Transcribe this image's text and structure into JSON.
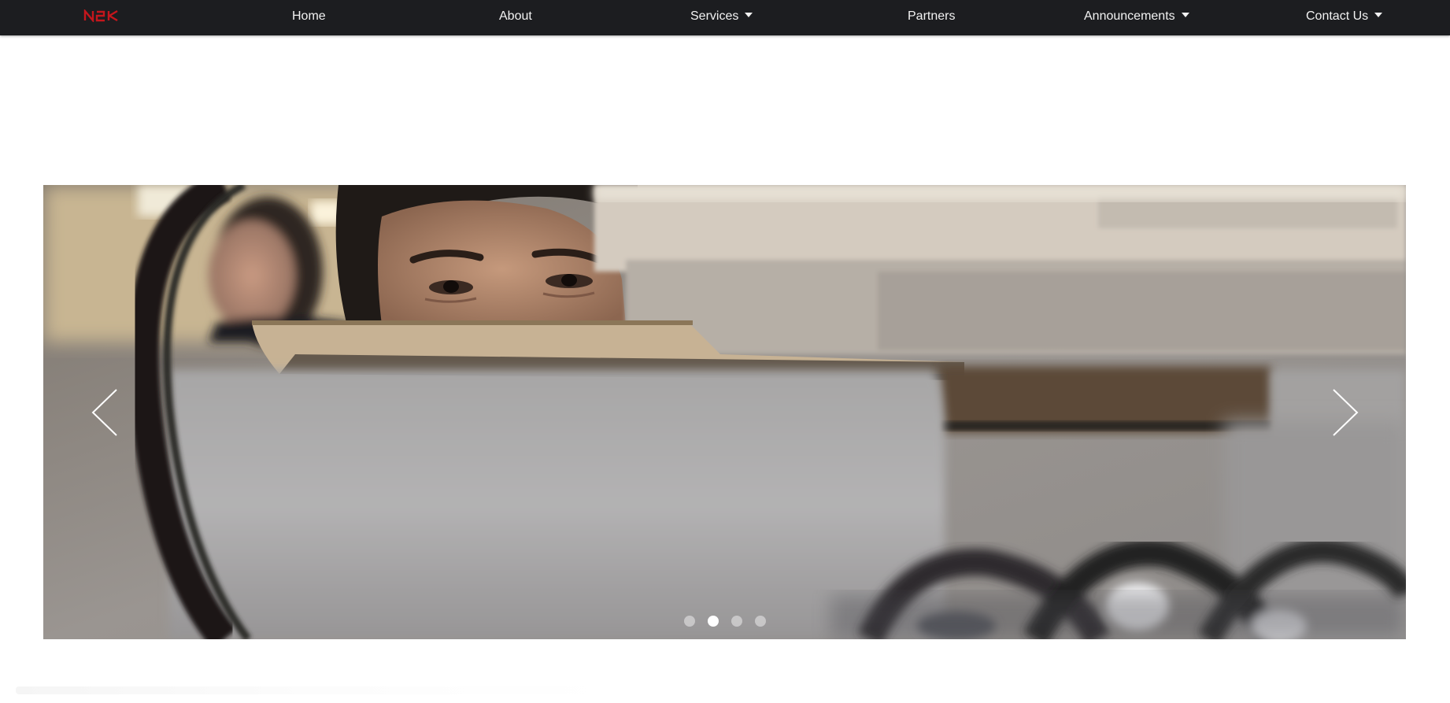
{
  "brand": {
    "logo_text": "N2K",
    "logo_color": "#c4161c"
  },
  "nav": {
    "background": "#1c1d20",
    "items": [
      {
        "label": "Home",
        "has_dropdown": false
      },
      {
        "label": "About",
        "has_dropdown": false
      },
      {
        "label": "Services",
        "has_dropdown": true
      },
      {
        "label": "Partners",
        "has_dropdown": false
      },
      {
        "label": "Announcements",
        "has_dropdown": true
      },
      {
        "label": "Contact Us",
        "has_dropdown": true
      }
    ]
  },
  "carousel": {
    "slide_count": 4,
    "active_index": 2,
    "prev_icon": "chevron-left-icon",
    "next_icon": "chevron-right-icon"
  }
}
